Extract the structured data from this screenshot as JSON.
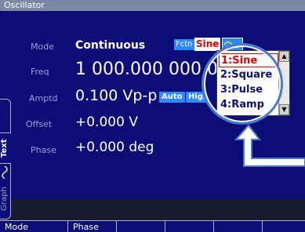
{
  "window": {
    "title": "Oscillator"
  },
  "params": {
    "mode": {
      "label": "Mode",
      "value": "Continuous"
    },
    "freq": {
      "label": "Freq",
      "value": "1 000.000 000 00"
    },
    "amptd": {
      "label": "Amptd",
      "value": "0.100 Vp-p"
    },
    "offset": {
      "label": "Offset",
      "value": "+0.000 V"
    },
    "phase": {
      "label": "Phase",
      "value": "+0.000 deg"
    }
  },
  "badges": {
    "fctn": "Fctn",
    "waveform": "Sine",
    "auto": "Auto",
    "high": "High"
  },
  "side_tabs": {
    "text": "Text",
    "graph": "Graph"
  },
  "dropdown": {
    "options": [
      "1:Sine",
      "2:Square",
      "3:Pulse",
      "4:Ramp"
    ],
    "selected_index": 0
  },
  "softkeys": [
    "Mode",
    "Phase",
    "",
    "",
    "",
    ""
  ],
  "colors": {
    "screen_bg": "#0d0d78",
    "title_bg": "#7a8aa6",
    "label": "#9aa0d8",
    "accent": "#2e88ff",
    "selected_option": "#e00000"
  }
}
